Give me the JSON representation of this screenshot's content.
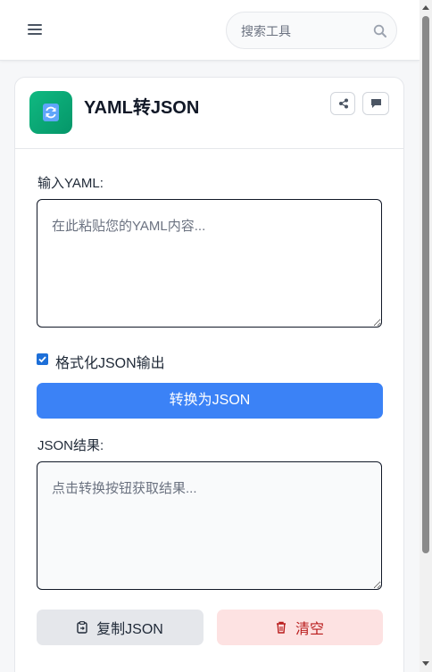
{
  "header": {
    "search_placeholder": "搜索工具",
    "menu_icon": "hamburger-menu-icon",
    "search_icon": "search-icon"
  },
  "tool": {
    "title": "YAML转JSON",
    "icon": "refresh-convert-icon",
    "share_icon": "share-icon",
    "feedback_icon": "comment-icon",
    "input_label": "输入YAML:",
    "input_placeholder": "在此粘贴您的YAML内容...",
    "format_checkbox_label": "格式化JSON输出",
    "format_checked": true,
    "convert_label": "转换为JSON",
    "output_label": "JSON结果:",
    "output_placeholder": "点击转换按钮获取结果...",
    "copy_label": "复制JSON",
    "clear_label": "清空"
  },
  "colors": {
    "primary": "#3b82f6",
    "app_icon": "#10b981",
    "danger_text": "#b91c1c",
    "danger_bg": "#fde2e2"
  }
}
